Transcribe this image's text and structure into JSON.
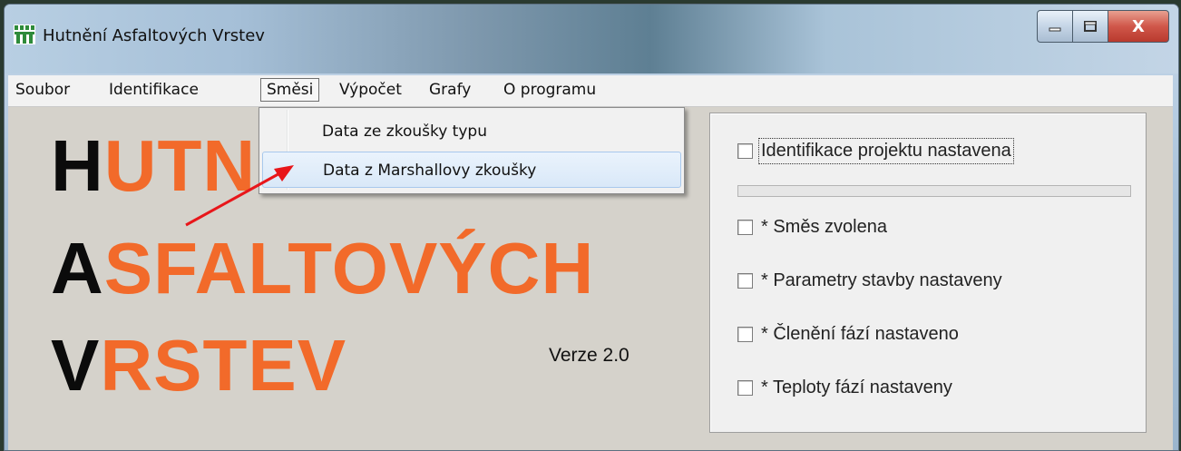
{
  "window": {
    "title": "Hutnění Asfaltových Vrstev",
    "controls": {
      "minimize_icon": "minimize-icon",
      "maximize_icon": "maximize-icon",
      "close_label": "X"
    }
  },
  "menubar": {
    "items": [
      {
        "label": "Soubor"
      },
      {
        "label": "Identifikace"
      },
      {
        "label": "Směsi"
      },
      {
        "label": "Výpočet"
      },
      {
        "label": "Grafy"
      },
      {
        "label": "O programu"
      }
    ],
    "active": "Směsi"
  },
  "dropdown": {
    "items": [
      {
        "label": "Data ze zkoušky typu"
      },
      {
        "label": "Data z Marshallovy  zkoušky"
      }
    ],
    "highlighted": "Data z Marshallovy  zkoušky"
  },
  "logo": {
    "line1": {
      "first": "H",
      "rest": "UTN"
    },
    "line2": {
      "first": "A",
      "rest": "SFALTOVÝCH"
    },
    "line3": {
      "first": "V",
      "rest": "RSTEV"
    },
    "colors": {
      "first": "#0b0b0b",
      "rest": "#f26a2a"
    }
  },
  "version": "Verze 2.0",
  "status_panel": {
    "checks": [
      {
        "label": "Identifikace projektu nastavena",
        "checked": false
      },
      {
        "label": "* Směs zvolena",
        "checked": false
      },
      {
        "label": "* Parametry stavby nastaveny",
        "checked": false
      },
      {
        "label": "* Členění fází nastaveno",
        "checked": false
      },
      {
        "label": "* Teploty fází nastaveny",
        "checked": false
      }
    ],
    "progress": 0
  },
  "annotation": {
    "arrow_color": "#e8161a"
  }
}
